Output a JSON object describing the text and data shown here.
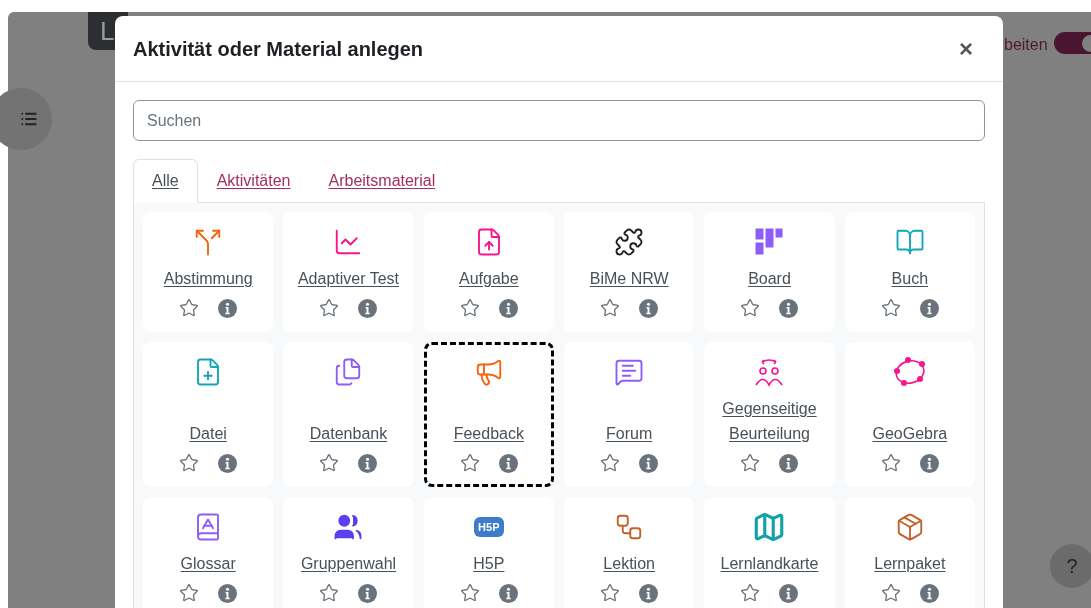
{
  "background": {
    "logo": {
      "text": "L"
    },
    "edit_mode": {
      "label": "beiten",
      "on": true
    },
    "help": {
      "label": "?"
    }
  },
  "dialog": {
    "title": "Aktivität oder Material anlegen",
    "close": "×",
    "search": {
      "placeholder": "Suchen"
    },
    "tabs": [
      {
        "label": "Alle",
        "selected": true
      },
      {
        "label": "Aktivitäten",
        "selected": false
      },
      {
        "label": "Arbeitsmaterial",
        "selected": false
      }
    ],
    "items": [
      {
        "name": "Abstimmung",
        "kind": "split",
        "color": "#f7630c",
        "starred": false,
        "focused": false
      },
      {
        "name": "Adaptiver Test",
        "kind": "chart",
        "color": "#f7148c",
        "starred": false,
        "focused": false
      },
      {
        "name": "Aufgabe",
        "kind": "file-up",
        "color": "#f7148c",
        "starred": false,
        "focused": false
      },
      {
        "name": "BiMe NRW",
        "kind": "puzzle",
        "color": "#1d2125",
        "starred": false,
        "focused": false
      },
      {
        "name": "Board",
        "kind": "board",
        "color": "#8e5cf7",
        "starred": false,
        "focused": false
      },
      {
        "name": "Buch",
        "kind": "book",
        "color": "#11a6b8",
        "starred": false,
        "focused": false
      },
      {
        "name": "Datei",
        "kind": "file-plus",
        "color": "#11a6b8",
        "starred": false,
        "focused": false
      },
      {
        "name": "Datenbank",
        "kind": "files",
        "color": "#8e5cf7",
        "starred": false,
        "focused": false
      },
      {
        "name": "Feedback",
        "kind": "megaphone",
        "color": "#f7630c",
        "starred": false,
        "focused": true
      },
      {
        "name": "Forum",
        "kind": "chat",
        "color": "#8e5cf7",
        "starred": false,
        "focused": false
      },
      {
        "name": "Gegenseitige Beurteilung",
        "kind": "peers",
        "color": "#f7148c",
        "starred": false,
        "focused": false
      },
      {
        "name": "GeoGebra",
        "kind": "geogebra",
        "color": "#f7148c",
        "starred": false,
        "focused": false
      },
      {
        "name": "Glossar",
        "kind": "glossary",
        "color": "#8e5cf7",
        "starred": false,
        "focused": false
      },
      {
        "name": "Gruppenwahl",
        "kind": "users",
        "color": "#5b3ff0",
        "starred": false,
        "focused": false
      },
      {
        "name": "H5P",
        "kind": "badge",
        "logo_text": "H5P",
        "color": "#3d7cc9",
        "starred": false,
        "focused": false
      },
      {
        "name": "Lektion",
        "kind": "workflow",
        "color": "#c4602a",
        "starred": false,
        "focused": false
      },
      {
        "name": "Lernlandkarte",
        "kind": "map",
        "color": "#13a1a8",
        "starred": false,
        "focused": false
      },
      {
        "name": "Lernpaket",
        "kind": "package",
        "color": "#c4602a",
        "starred": false,
        "focused": false
      }
    ]
  }
}
